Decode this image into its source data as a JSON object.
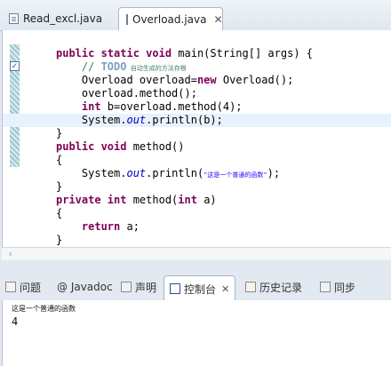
{
  "editor_tabs": [
    {
      "label": "Read_excl.java"
    },
    {
      "label": "Overload.java",
      "close": "✕"
    }
  ],
  "code": {
    "l1": {
      "kw": "public static void ",
      "rest": "main(String[] args) {"
    },
    "l2": {
      "prefix": "    // ",
      "todo": "TODO",
      "comment": " 自动生成的方法存根"
    },
    "l3": {
      "text": "    Overload overload=",
      "kw": "new",
      "rest": " Overload();"
    },
    "l4": {
      "text": "    overload.method();"
    },
    "l5": {
      "kw": "    int",
      "rest": " b=overload.method(4);"
    },
    "l6": {
      "pre": "    System.",
      "it": "out",
      "rest": ".println(b);"
    },
    "l7": {
      "text": "}"
    },
    "l8": {
      "kw": "public void ",
      "rest": "method()"
    },
    "l9": {
      "text": "{"
    },
    "l10": {
      "pre": "    System.",
      "it": "out",
      "mid": ".println(",
      "str": "\"这是一个普通的函数\"",
      "end": ");"
    },
    "l11": {
      "text": "}"
    },
    "l12": {
      "kw1": "private int ",
      "mid": "method(",
      "kw2": "int",
      "end": " a)"
    },
    "l13": {
      "text": "{"
    },
    "l14": {
      "kw": "    return",
      "rest": " a;"
    },
    "l15": {
      "text": "}"
    }
  },
  "view_tabs": [
    {
      "label": "问题"
    },
    {
      "label": "@ Javadoc"
    },
    {
      "label": "声明"
    },
    {
      "label": "控制台",
      "close": "✕"
    },
    {
      "label": "历史记录"
    },
    {
      "label": "同步"
    }
  ],
  "console": {
    "line1": "这是一个普通的函数",
    "line2": "4"
  },
  "colors": {
    "keyword": "#7f0055",
    "comment": "#3f7f5f",
    "string": "#2a00ff",
    "field": "#0000c0"
  }
}
